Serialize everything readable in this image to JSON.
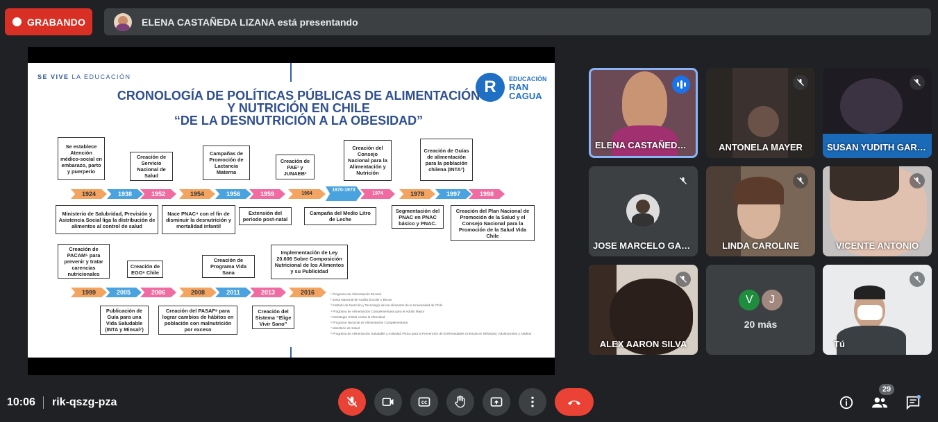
{
  "topbar": {
    "recording_label": "GRABANDO",
    "presenting_text": "ELENA CASTAÑEDA LIZANA está presentando"
  },
  "slide": {
    "brand_bold": "SE VIVE",
    "brand_rest": " LA EDUCACIÓN",
    "logo_letter": "R",
    "logo_line1": "EDUCACIÓN",
    "logo_line2a": "RAN",
    "logo_line2b": "CAGUA",
    "title_line1": "CRONOLOGÍA DE POLÍTICAS PÚBLICAS DE ALIMENTACIÓN",
    "title_line2": "Y NUTRICIÓN EN CHILE",
    "title_line3": "“DE LA DESNUTRICIÓN A LA OBESIDAD”",
    "timeline1_years": [
      "1924",
      "1938",
      "1952",
      "1954",
      "1956",
      "1959",
      "1964",
      "1970-1973",
      "1974",
      "1978",
      "1997",
      "1998"
    ],
    "timeline2_years": [
      "1999",
      "2005",
      "2006",
      "2008",
      "2011",
      "2013",
      "2016"
    ],
    "top_boxes": [
      "Se establece Atención médico-social en embarazo, parto y puerperio",
      "Creación de Servicio Nacional de Salud",
      "Campañas de Promoción de Lactancia Materna",
      "Creación de PAE¹ y JUNAEB²",
      "Creación del Consejo Nacional para la Alimentación y Nutrición",
      "Creación de Guías de alimentación para la población chilena (INTA³)"
    ],
    "bottom_boxes": [
      "Ministerio de Salubridad, Previsión y Asistencia Social liga la distribución de alimentos al control de salud",
      "Nace PNAC⁴ con el fin de disminuir la desnutrición y mortalidad infantil",
      "Extensión del periodo post-natal",
      "Campaña del Medio Litro de Leche",
      "Segmentación del PNAC en PNAC básico y PNAC.",
      "Creación del Plan Nacional de Promoción de la Salud y el Consejo Nacional para la Promoción de la Salud Vida Chile"
    ],
    "top_boxes2": [
      "Creación de PACAM⁵ para prevenir y tratar carencias nutricionales",
      "Creación de EGO⁶ Chile",
      "Creación de Programa Vida Sana",
      "Implementación de Ley 20.606 Sobre Composición Nutricional de los Alimentos y su Publicidad"
    ],
    "bottom_boxes2": [
      "Publicación de Guía para una Vida Saludable (INTA y Minsal⁷)",
      "Creación del PASAF⁸ para lograr cambios de hábitos en población con malnutrición por exceso",
      "Creación del Sistema “Elige Vivir Sano”"
    ],
    "footnotes": [
      "¹ Programa de Alimentación Escolar",
      "² Junta Nacional de Auxilio Escolar y Becas",
      "³ Instituto de Nutrición y Tecnología de los Alimentos de la Universidad de Chile",
      "⁴ Programa de Alimentación Complementaria para el Adulto Mayor",
      "⁵ Estrategia Global contra la Obesidad",
      "⁶ Programa Nacional de Alimentación Complementaria",
      "⁷ Ministerio de Salud",
      "⁸ Programa de Alimentación Saludable y Actividad Física para la Prevención de Enfermedades Crónicas en Niños(as), Adolescentes y Adultos"
    ]
  },
  "participants": [
    {
      "name": "ELENA CASTAÑEDA LIZANA"
    },
    {
      "name": "ANTONELA MAYER"
    },
    {
      "name": "SUSAN YUDITH GARCÍA"
    },
    {
      "name": "JOSE MARCELO GARCÍA"
    },
    {
      "name": "LINDA CAROLINE"
    },
    {
      "name": "VICENTE ANTONIO"
    },
    {
      "name": "ALEX AARON SILVA"
    },
    {
      "name": "20 más",
      "avatars": [
        "V",
        "J"
      ]
    },
    {
      "name": "Tú"
    }
  ],
  "bottombar": {
    "time": "10:06",
    "meeting_code": "rik-qszg-pza",
    "people_count": "29"
  },
  "colors": {
    "record": "#d93025",
    "hangup": "#ea4335",
    "speaking": "#1a73e8"
  }
}
